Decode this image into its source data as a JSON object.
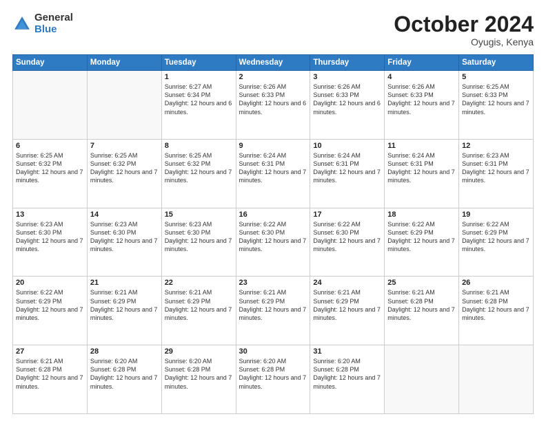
{
  "logo": {
    "general": "General",
    "blue": "Blue"
  },
  "title": "October 2024",
  "subtitle": "Oyugis, Kenya",
  "days_header": [
    "Sunday",
    "Monday",
    "Tuesday",
    "Wednesday",
    "Thursday",
    "Friday",
    "Saturday"
  ],
  "weeks": [
    [
      {
        "day": "",
        "info": ""
      },
      {
        "day": "",
        "info": ""
      },
      {
        "day": "1",
        "info": "Sunrise: 6:27 AM\nSunset: 6:34 PM\nDaylight: 12 hours and 6 minutes."
      },
      {
        "day": "2",
        "info": "Sunrise: 6:26 AM\nSunset: 6:33 PM\nDaylight: 12 hours and 6 minutes."
      },
      {
        "day": "3",
        "info": "Sunrise: 6:26 AM\nSunset: 6:33 PM\nDaylight: 12 hours and 6 minutes."
      },
      {
        "day": "4",
        "info": "Sunrise: 6:26 AM\nSunset: 6:33 PM\nDaylight: 12 hours and 7 minutes."
      },
      {
        "day": "5",
        "info": "Sunrise: 6:25 AM\nSunset: 6:33 PM\nDaylight: 12 hours and 7 minutes."
      }
    ],
    [
      {
        "day": "6",
        "info": "Sunrise: 6:25 AM\nSunset: 6:32 PM\nDaylight: 12 hours and 7 minutes."
      },
      {
        "day": "7",
        "info": "Sunrise: 6:25 AM\nSunset: 6:32 PM\nDaylight: 12 hours and 7 minutes."
      },
      {
        "day": "8",
        "info": "Sunrise: 6:25 AM\nSunset: 6:32 PM\nDaylight: 12 hours and 7 minutes."
      },
      {
        "day": "9",
        "info": "Sunrise: 6:24 AM\nSunset: 6:31 PM\nDaylight: 12 hours and 7 minutes."
      },
      {
        "day": "10",
        "info": "Sunrise: 6:24 AM\nSunset: 6:31 PM\nDaylight: 12 hours and 7 minutes."
      },
      {
        "day": "11",
        "info": "Sunrise: 6:24 AM\nSunset: 6:31 PM\nDaylight: 12 hours and 7 minutes."
      },
      {
        "day": "12",
        "info": "Sunrise: 6:23 AM\nSunset: 6:31 PM\nDaylight: 12 hours and 7 minutes."
      }
    ],
    [
      {
        "day": "13",
        "info": "Sunrise: 6:23 AM\nSunset: 6:30 PM\nDaylight: 12 hours and 7 minutes."
      },
      {
        "day": "14",
        "info": "Sunrise: 6:23 AM\nSunset: 6:30 PM\nDaylight: 12 hours and 7 minutes."
      },
      {
        "day": "15",
        "info": "Sunrise: 6:23 AM\nSunset: 6:30 PM\nDaylight: 12 hours and 7 minutes."
      },
      {
        "day": "16",
        "info": "Sunrise: 6:22 AM\nSunset: 6:30 PM\nDaylight: 12 hours and 7 minutes."
      },
      {
        "day": "17",
        "info": "Sunrise: 6:22 AM\nSunset: 6:30 PM\nDaylight: 12 hours and 7 minutes."
      },
      {
        "day": "18",
        "info": "Sunrise: 6:22 AM\nSunset: 6:29 PM\nDaylight: 12 hours and 7 minutes."
      },
      {
        "day": "19",
        "info": "Sunrise: 6:22 AM\nSunset: 6:29 PM\nDaylight: 12 hours and 7 minutes."
      }
    ],
    [
      {
        "day": "20",
        "info": "Sunrise: 6:22 AM\nSunset: 6:29 PM\nDaylight: 12 hours and 7 minutes."
      },
      {
        "day": "21",
        "info": "Sunrise: 6:21 AM\nSunset: 6:29 PM\nDaylight: 12 hours and 7 minutes."
      },
      {
        "day": "22",
        "info": "Sunrise: 6:21 AM\nSunset: 6:29 PM\nDaylight: 12 hours and 7 minutes."
      },
      {
        "day": "23",
        "info": "Sunrise: 6:21 AM\nSunset: 6:29 PM\nDaylight: 12 hours and 7 minutes."
      },
      {
        "day": "24",
        "info": "Sunrise: 6:21 AM\nSunset: 6:29 PM\nDaylight: 12 hours and 7 minutes."
      },
      {
        "day": "25",
        "info": "Sunrise: 6:21 AM\nSunset: 6:28 PM\nDaylight: 12 hours and 7 minutes."
      },
      {
        "day": "26",
        "info": "Sunrise: 6:21 AM\nSunset: 6:28 PM\nDaylight: 12 hours and 7 minutes."
      }
    ],
    [
      {
        "day": "27",
        "info": "Sunrise: 6:21 AM\nSunset: 6:28 PM\nDaylight: 12 hours and 7 minutes."
      },
      {
        "day": "28",
        "info": "Sunrise: 6:20 AM\nSunset: 6:28 PM\nDaylight: 12 hours and 7 minutes."
      },
      {
        "day": "29",
        "info": "Sunrise: 6:20 AM\nSunset: 6:28 PM\nDaylight: 12 hours and 7 minutes."
      },
      {
        "day": "30",
        "info": "Sunrise: 6:20 AM\nSunset: 6:28 PM\nDaylight: 12 hours and 7 minutes."
      },
      {
        "day": "31",
        "info": "Sunrise: 6:20 AM\nSunset: 6:28 PM\nDaylight: 12 hours and 7 minutes."
      },
      {
        "day": "",
        "info": ""
      },
      {
        "day": "",
        "info": ""
      }
    ]
  ]
}
